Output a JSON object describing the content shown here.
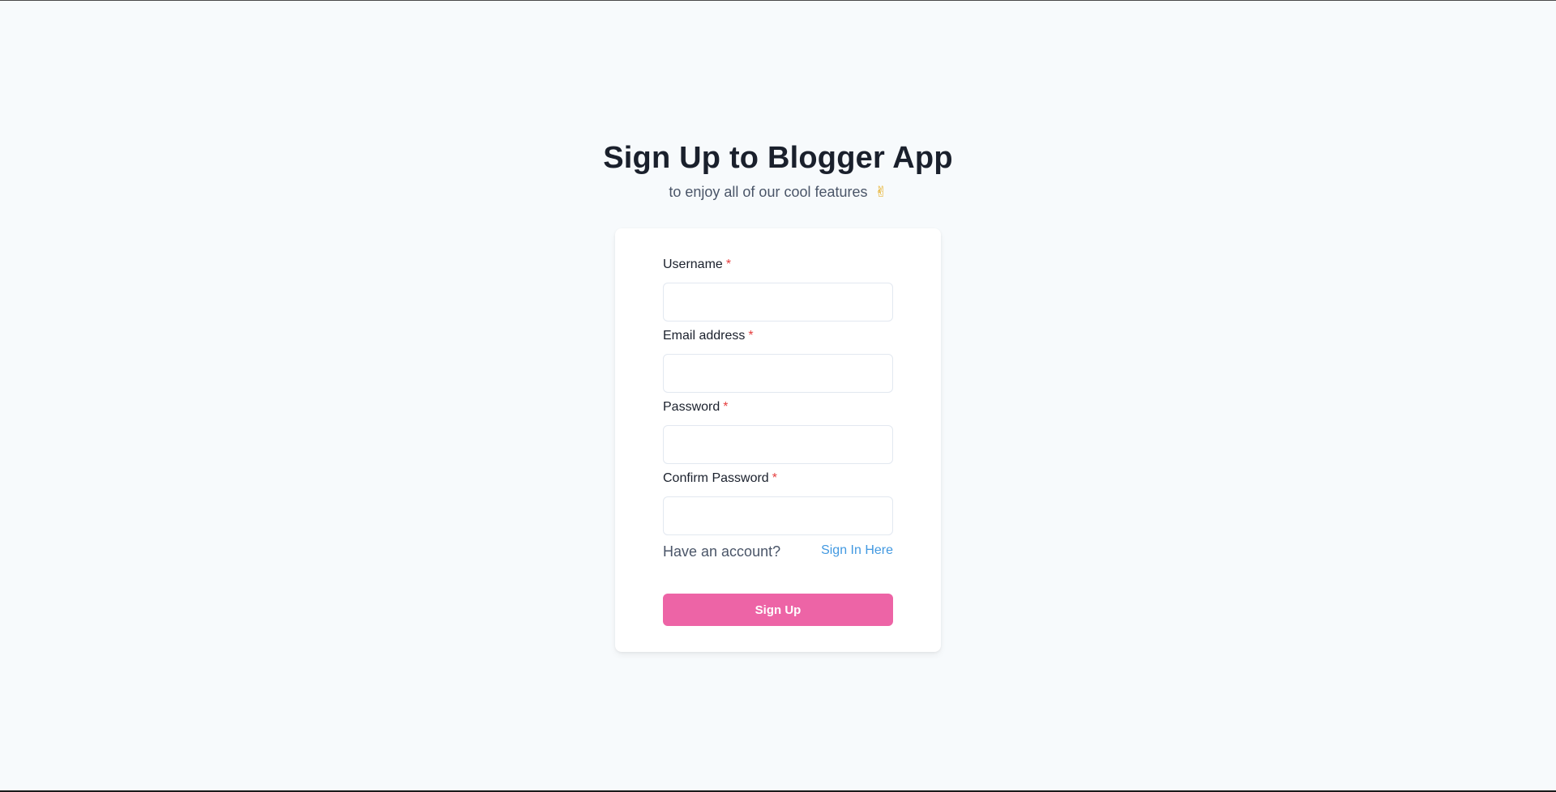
{
  "header": {
    "title": "Sign Up to Blogger App",
    "subtitle": "to enjoy all of our cool features",
    "subtitle_emoji": "✌"
  },
  "form": {
    "required_marker": "*",
    "fields": [
      {
        "label": "Username",
        "value": "",
        "type": "text"
      },
      {
        "label": "Email address",
        "value": "",
        "type": "email"
      },
      {
        "label": "Password",
        "value": "",
        "type": "password"
      },
      {
        "label": "Confirm Password",
        "value": "",
        "type": "password"
      }
    ],
    "account_prompt": "Have an account?",
    "signin_link": "Sign In Here",
    "submit_label": "Sign Up"
  },
  "colors": {
    "background": "#f7fafc",
    "accent_button": "#ed64a6",
    "link": "#4299e1",
    "required": "#e53e3e"
  }
}
